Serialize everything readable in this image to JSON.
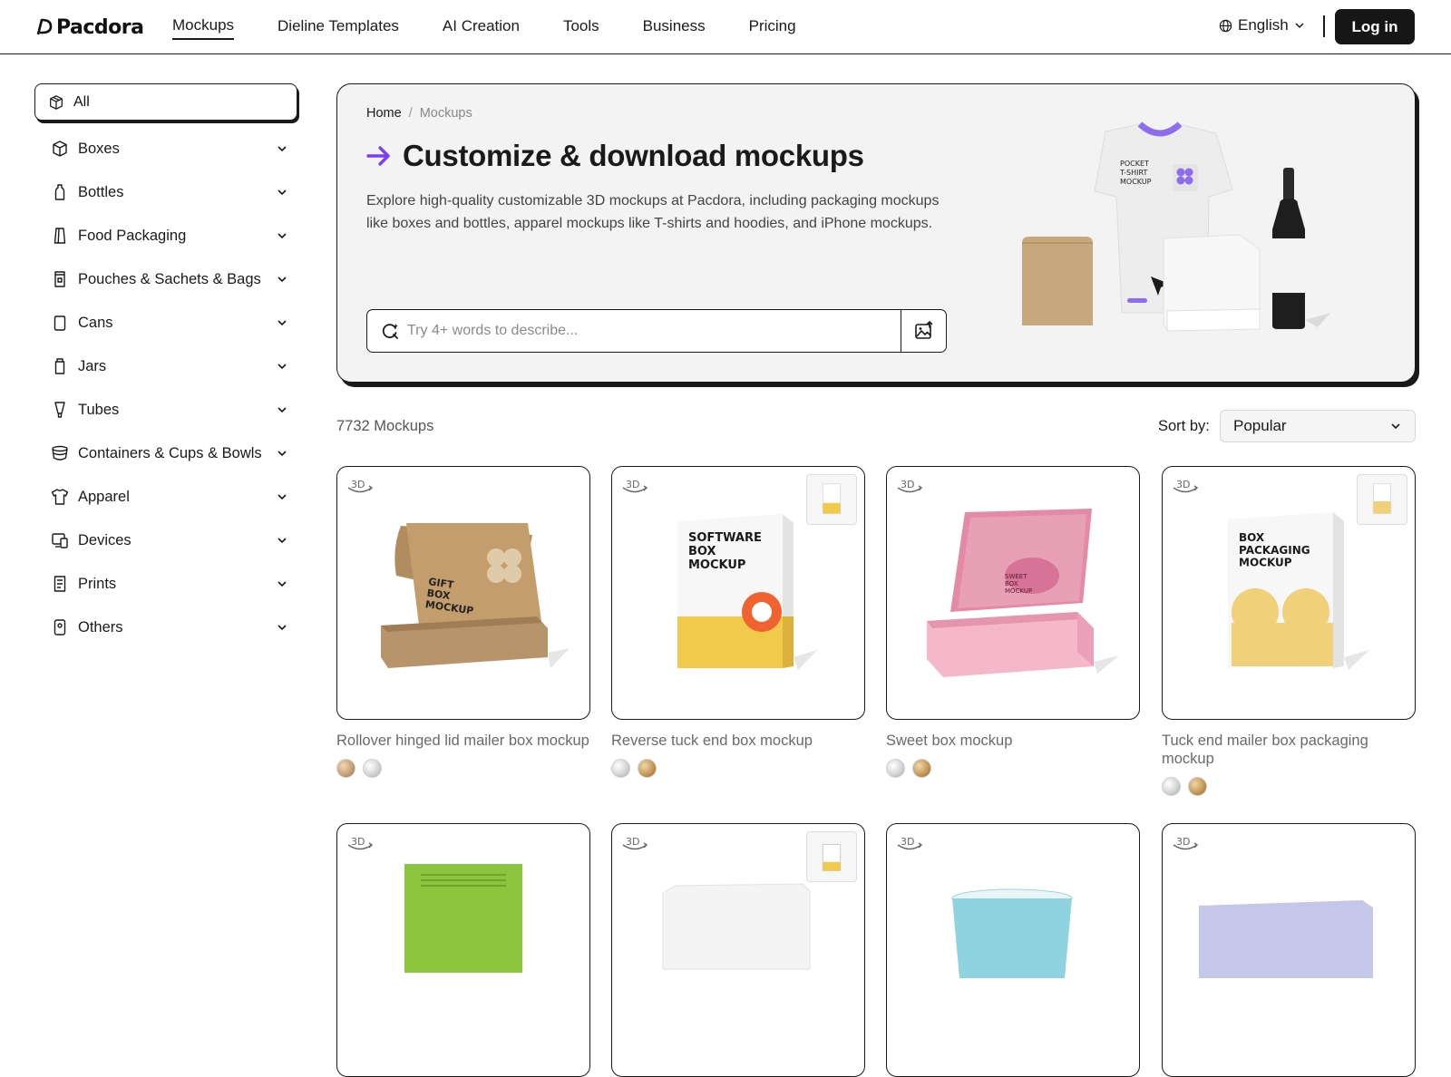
{
  "header": {
    "logo": "Pacdora",
    "nav": [
      "Mockups",
      "Dieline Templates",
      "AI Creation",
      "Tools",
      "Business",
      "Pricing"
    ],
    "language": "English",
    "login_label": "Log in"
  },
  "sidebar": {
    "all_label": "All",
    "items": [
      {
        "label": "Boxes",
        "icon": "box-icon"
      },
      {
        "label": "Bottles",
        "icon": "bottle-icon"
      },
      {
        "label": "Food Packaging",
        "icon": "food-package-icon"
      },
      {
        "label": "Pouches & Sachets & Bags",
        "icon": "pouch-icon"
      },
      {
        "label": "Cans",
        "icon": "can-icon"
      },
      {
        "label": "Jars",
        "icon": "jar-icon"
      },
      {
        "label": "Tubes",
        "icon": "tube-icon"
      },
      {
        "label": "Containers & Cups & Bowls",
        "icon": "bowl-icon"
      },
      {
        "label": "Apparel",
        "icon": "tshirt-icon"
      },
      {
        "label": "Devices",
        "icon": "device-icon"
      },
      {
        "label": "Prints",
        "icon": "document-icon"
      },
      {
        "label": "Others",
        "icon": "other-icon"
      }
    ]
  },
  "hero": {
    "breadcrumb_home": "Home",
    "breadcrumb_sep": "/",
    "breadcrumb_current": "Mockups",
    "title": "Customize & download mockups",
    "description": "Explore high-quality customizable 3D mockups at Pacdora, including packaging mockups like boxes and bottles, apparel mockups like T-shirts and hoodies, and iPhone mockups.",
    "search_placeholder": "Try 4+ words to describe...",
    "shirt_text": "POCKET\nT-SHIRT\nMOCKUP",
    "accent_color": "#7b3ff2"
  },
  "results": {
    "count_label": "7732 Mockups",
    "sort_label": "Sort by:",
    "sort_value": "Popular"
  },
  "cards": [
    {
      "title": "Rollover hinged lid mailer box mockup",
      "badge": "3D",
      "mini_thumb": false,
      "swatches": [
        "kraft",
        "silver"
      ],
      "art": "kraft-mailer",
      "art_text": "GIFT BOX MOCKUP"
    },
    {
      "title": "Reverse tuck end box mockup",
      "badge": "3D",
      "mini_thumb": true,
      "swatches": [
        "silver",
        "gold"
      ],
      "art": "tuck-box",
      "art_text": "SOFTWARE BOX MOCKUP"
    },
    {
      "title": "Sweet box mockup",
      "badge": "3D",
      "mini_thumb": false,
      "swatches": [
        "silver",
        "gold"
      ],
      "art": "pink-mailer",
      "art_text": "SWEET BOX MOCKUP"
    },
    {
      "title": "Tuck end mailer box packaging mockup",
      "badge": "3D",
      "mini_thumb": true,
      "swatches": [
        "silver",
        "gold"
      ],
      "art": "yellow-box",
      "art_text": "BOX PACKAGING MOCKUP"
    },
    {
      "title": "",
      "badge": "3D",
      "mini_thumb": false,
      "swatches": [],
      "art": "green-card",
      "art_text": ""
    },
    {
      "title": "",
      "badge": "3D",
      "mini_thumb": true,
      "swatches": [],
      "art": "white-box",
      "art_text": ""
    },
    {
      "title": "",
      "badge": "3D",
      "mini_thumb": false,
      "swatches": [],
      "art": "blue-cup",
      "art_text": ""
    },
    {
      "title": "",
      "badge": "3D",
      "mini_thumb": false,
      "swatches": [],
      "art": "lavender-box",
      "art_text": ""
    }
  ]
}
